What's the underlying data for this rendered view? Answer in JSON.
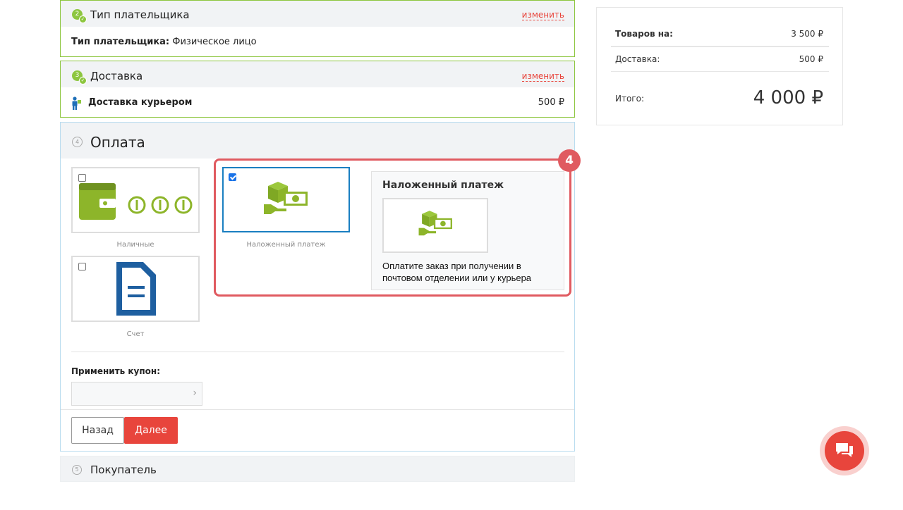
{
  "steps": {
    "payer": {
      "number": "2",
      "title": "Тип плательщика",
      "change_label": "изменить",
      "field_label": "Тип плательщика:",
      "field_value": "Физическое лицо"
    },
    "delivery": {
      "number": "3",
      "title": "Доставка",
      "change_label": "изменить",
      "method": "Доставка курьером",
      "price": "500 ₽"
    },
    "payment": {
      "number": "4",
      "title": "Оплата"
    },
    "buyer": {
      "number": "5",
      "title": "Покупатель"
    }
  },
  "payment_options": [
    {
      "label": "Наличные",
      "checked": false,
      "icon": "wallet-coins-icon"
    },
    {
      "label": "Наложенный платеж",
      "checked": true,
      "icon": "cash-on-delivery-icon"
    },
    {
      "label": "Счет",
      "checked": false,
      "icon": "invoice-document-icon"
    }
  ],
  "payment_detail": {
    "title": "Наложенный платеж",
    "description_line1": "Оплатите заказ при получении в",
    "description_line2": "почтовом отделении или у курьера"
  },
  "highlight_badge": "4",
  "coupon": {
    "label": "Применить купон:",
    "value": "",
    "placeholder": ""
  },
  "buttons": {
    "back": "Назад",
    "next": "Далее"
  },
  "summary": {
    "items_label": "Товаров на:",
    "items_value": "3 500 ₽",
    "delivery_label": "Доставка:",
    "delivery_value": "500 ₽",
    "total_label": "Итого:",
    "total_value": "4 000 ₽"
  },
  "colors": {
    "accent_green": "#8dc63f",
    "accent_red": "#e8453c",
    "invoice_blue": "#1e5fa0",
    "selected_blue": "#1a7fc1"
  }
}
